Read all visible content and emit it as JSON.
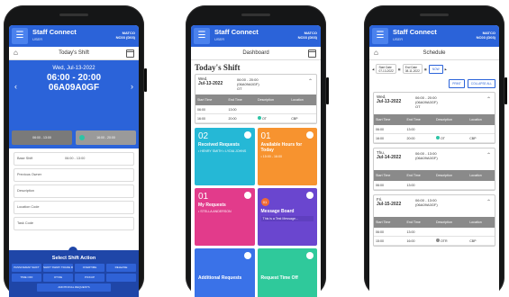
{
  "app": {
    "title": "Staff Connect",
    "subtitle": "USER",
    "right_line1": "MATCO",
    "right_line2": "NC03 (D03)"
  },
  "icons": {
    "menu": "menu-icon",
    "home": "home-icon",
    "calendar": "calendar-icon",
    "chevron": "chevron-icon"
  },
  "colors": {
    "primary": "#2b63d9",
    "action_bg": "#1f46a8",
    "teal": "#2ec4a6",
    "orange": "#f7932f",
    "pink": "#e23b8b",
    "purple": "#6a46cf",
    "green": "#2fc99b",
    "blue": "#3a72e8"
  },
  "phone1": {
    "header": "Today's Shift",
    "date": "Wed, Jul-13-2022",
    "time": "06:00 - 20:00",
    "code": "06A09A0GF",
    "chips": [
      "06:00 - 13:00",
      "16:00 - 20:00"
    ],
    "fields": [
      {
        "label": "Base Shift",
        "value": "06:00 - 13:00"
      },
      {
        "label": "Previous Owner",
        "value": ""
      },
      {
        "label": "Description",
        "value": ""
      },
      {
        "label": "Location Code",
        "value": ""
      },
      {
        "label": "Task Code",
        "value": ""
      }
    ],
    "action_title": "Select Shift Action",
    "actions": [
      "PASSIVEMAP SHIFT",
      "SHIFT SWAP/ TRADE REQUEST",
      "OVERTIME",
      "RELEASE",
      "TIME OFF",
      "OT/OE",
      "PICKUP",
      "",
      "ADDITIONAL REQUESTS"
    ]
  },
  "phone2": {
    "header": "Dashboard",
    "today_title": "Today's Shift",
    "shift": {
      "day": "Wed,",
      "date": "Jul-13-2022",
      "time": "06:00 - 20:00",
      "code": "(06A09A0GF)",
      "type": "OT"
    },
    "table_headers": [
      "Start Time",
      "End Time",
      "Description",
      "Location"
    ],
    "rows": [
      {
        "start": "06:00",
        "end": "13:00",
        "desc": "",
        "loc": ""
      },
      {
        "start": "16:00",
        "end": "20:00",
        "desc": "OT",
        "loc": "CBP"
      }
    ],
    "tiles": [
      {
        "num": "02",
        "label": "Received Requests",
        "sub": "• HENRY SMITH • LYDIA JOHNS"
      },
      {
        "num": "01",
        "label": "Available Hours for Today",
        "sub": "• 15:00 - 16:00"
      },
      {
        "num": "01",
        "label": "My Requests",
        "sub": "• STELLA ANDERSON"
      },
      {
        "num": "01",
        "label": "Message Board",
        "sub": "This is a Test Message..."
      },
      {
        "num": "",
        "label": "Additional Requests",
        "sub": ""
      },
      {
        "num": "",
        "label": "Request Time Off",
        "sub": ""
      }
    ]
  },
  "phone3": {
    "header": "Schedule",
    "start_label": "Start Date",
    "start_value": "07-13-2022",
    "end_label": "End Date",
    "end_value": "08-11-2022",
    "go_label": "NOW",
    "print_label": "PRINT",
    "collapse_label": "COLLAPSE ALL",
    "table_headers": [
      "Start Time",
      "End Time",
      "Description",
      "Location"
    ],
    "days": [
      {
        "day": "Wed,",
        "date": "Jul-13-2022",
        "time": "06:00 - 20:00",
        "code": "(06A09A0GF)",
        "type": "OT",
        "rows": [
          {
            "start": "06:00",
            "end": "13:00",
            "desc": "",
            "loc": ""
          },
          {
            "start": "16:00",
            "end": "20:00",
            "desc": "OT",
            "loc": "CBP"
          }
        ]
      },
      {
        "day": "Thu,",
        "date": "Jul-14-2022",
        "time": "06:00 - 13:00",
        "code": "(06A09A0GF)",
        "type": "",
        "rows": [
          {
            "start": "06:00",
            "end": "13:00",
            "desc": "",
            "loc": ""
          }
        ]
      },
      {
        "day": "Fri,",
        "date": "Jul-15-2022",
        "time": "06:00 - 13:00",
        "code": "(06A09A0GF)",
        "type": "",
        "rows": [
          {
            "start": "06:00",
            "end": "13:00",
            "desc": "",
            "loc": ""
          },
          {
            "start": "15:00",
            "end": "16:00",
            "desc": "OTR",
            "loc": "CBP"
          }
        ]
      }
    ]
  }
}
